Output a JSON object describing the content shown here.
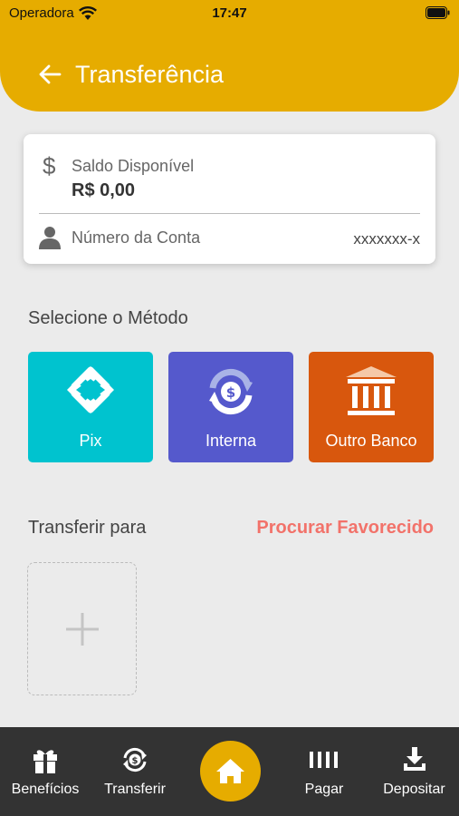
{
  "status_bar": {
    "carrier": "Operadora",
    "time": "17:47"
  },
  "header": {
    "title": "Transferência"
  },
  "account_card": {
    "balance_label": "Saldo Disponível",
    "balance_value": "R$ 0,00",
    "account_label": "Número da Conta",
    "account_value": "xxxxxxx-x"
  },
  "methods": {
    "section_label": "Selecione o Método",
    "items": [
      {
        "label": "Pix",
        "icon": "pix-icon",
        "color": "#00c3cf"
      },
      {
        "label": "Interna",
        "icon": "exchange-dollar-icon",
        "color": "#5559cc"
      },
      {
        "label": "Outro Banco",
        "icon": "bank-icon",
        "color": "#d8570d"
      }
    ]
  },
  "transfer": {
    "label": "Transferir para",
    "search_link": "Procurar Favorecido"
  },
  "bottom_nav": {
    "items": [
      {
        "label": "Benefícios",
        "icon": "gift-icon"
      },
      {
        "label": "Transferir",
        "icon": "transfer-icon"
      },
      {
        "label": "",
        "icon": "home-icon"
      },
      {
        "label": "Pagar",
        "icon": "barcode-icon"
      },
      {
        "label": "Depositar",
        "icon": "download-icon"
      }
    ]
  },
  "colors": {
    "header": "#e6ac00",
    "background": "#ebebeb",
    "accent_link": "#f2726a",
    "nav_bar": "#333333"
  }
}
